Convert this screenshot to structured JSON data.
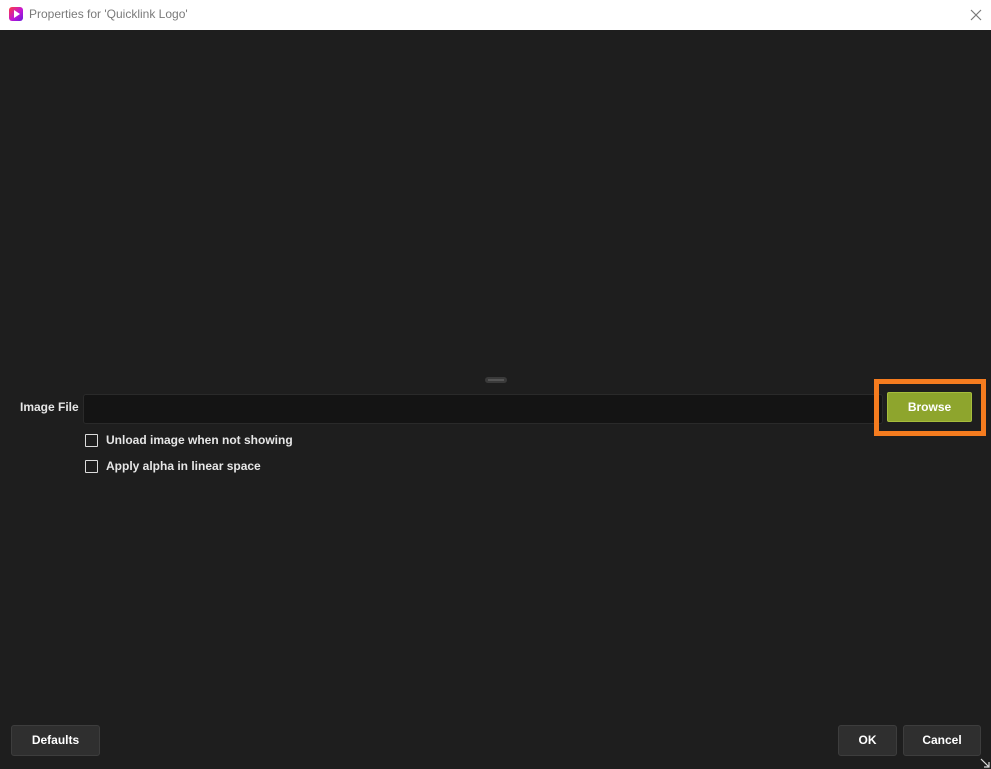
{
  "window": {
    "title": "Properties for 'Quicklink Logo'",
    "icon": "app-logo-icon",
    "close_icon": "close-icon"
  },
  "form": {
    "image_file_label": "Image File",
    "image_file_value": "",
    "browse_label": "Browse",
    "checkboxes": [
      {
        "label": "Unload image when not showing",
        "checked": false
      },
      {
        "label": "Apply alpha in linear space",
        "checked": false
      }
    ]
  },
  "footer": {
    "defaults_label": "Defaults",
    "ok_label": "OK",
    "cancel_label": "Cancel"
  },
  "colors": {
    "background": "#1e1e1e",
    "browse_button": "#8ea52d",
    "highlight_border": "#f57c1f",
    "titlebar": "#ffffff"
  }
}
